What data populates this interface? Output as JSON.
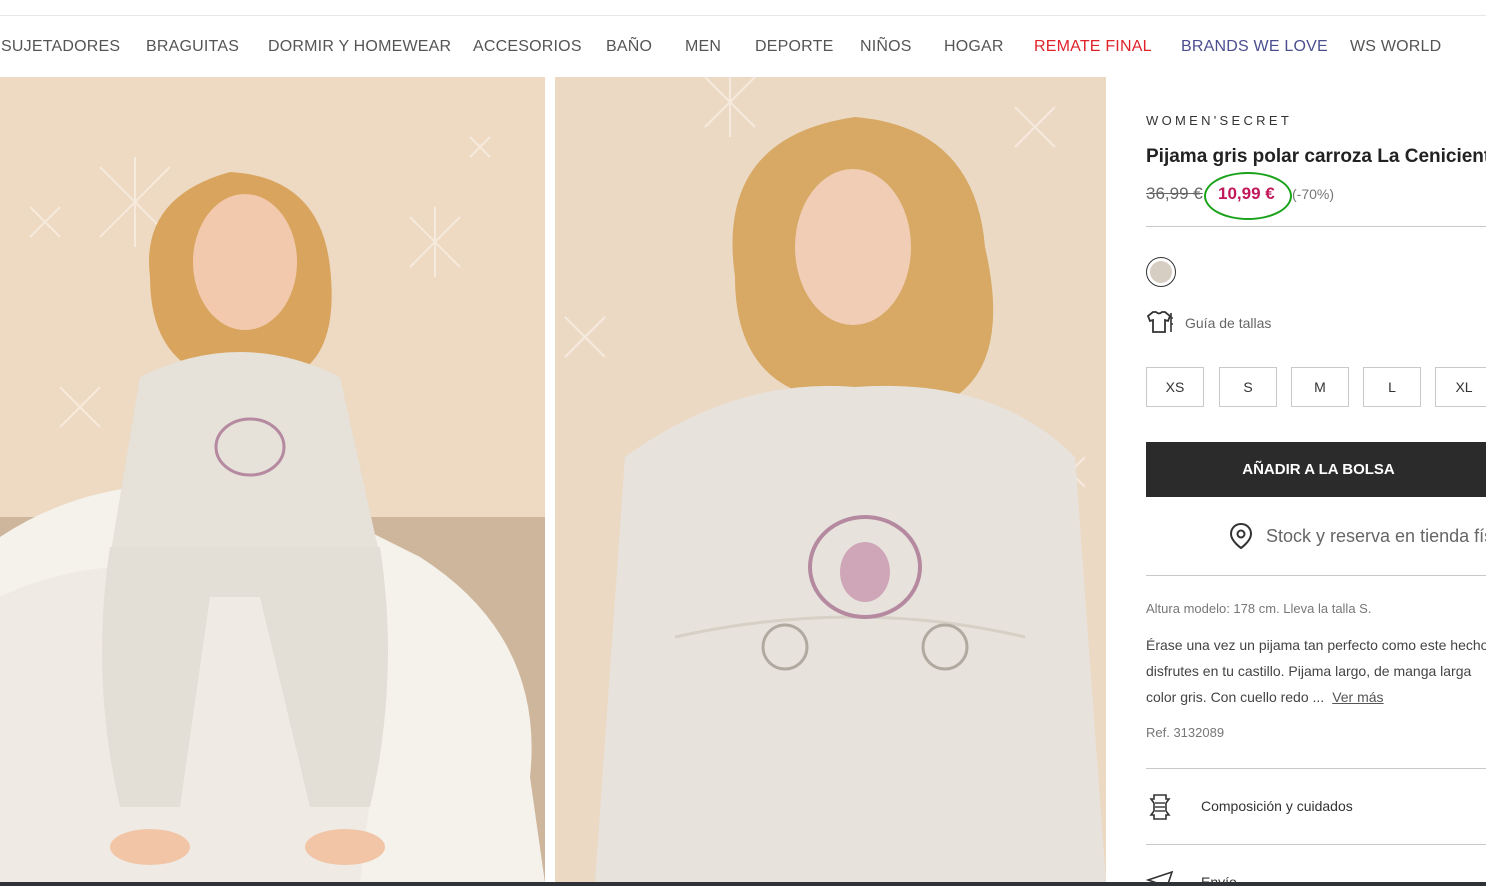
{
  "nav": {
    "items": [
      {
        "label": "SUJETADORES",
        "style": "normal"
      },
      {
        "label": "BRAGUITAS",
        "style": "normal"
      },
      {
        "label": "DORMIR Y HOMEWEAR",
        "style": "normal"
      },
      {
        "label": "ACCESORIOS",
        "style": "normal"
      },
      {
        "label": "BAÑO",
        "style": "normal"
      },
      {
        "label": "MEN",
        "style": "normal"
      },
      {
        "label": "DEPORTE",
        "style": "normal"
      },
      {
        "label": "NIÑOS",
        "style": "normal"
      },
      {
        "label": "HOGAR",
        "style": "normal"
      },
      {
        "label": "REMATE FINAL",
        "style": "red"
      },
      {
        "label": "BRANDS WE LOVE",
        "style": "purple"
      },
      {
        "label": "WS WORLD",
        "style": "normal"
      }
    ]
  },
  "product": {
    "brand": "WOMEN'SECRET",
    "title": "Pijama gris polar carroza La Cenicienta",
    "old_price": "36,99 €",
    "new_price": "10,99 €",
    "discount": "(-70%)",
    "color_swatch": "#d6cec2",
    "size_guide_label": "Guía de tallas",
    "sizes": [
      "XS",
      "S",
      "M",
      "L",
      "XL"
    ],
    "add_to_bag": "AÑADIR A LA BOLSA",
    "stock_label": "Stock y reserva en tienda física",
    "model_info": "Altura modelo: 178 cm.  Lleva la talla S.",
    "description_lines": [
      "Érase una vez un pijama tan perfecto como este hecho",
      "disfrutes en tu castillo. Pijama largo, de manga larga",
      "color gris. Con cuello redo ..."
    ],
    "more_label": "Ver más",
    "ref": "Ref. 3132089",
    "composition_label": "Composición y cuidados",
    "shipping_label": "Envío"
  },
  "colors": {
    "price": "#c2185b",
    "highlight_circle": "#1aa31a",
    "sale_nav": "#e0222a",
    "brands_nav": "#4b4f8f",
    "button_bg": "#2b2b2b"
  },
  "images": {
    "photo1": "model-sitting-grey-pajama",
    "photo2": "model-standing-grey-pajama"
  }
}
